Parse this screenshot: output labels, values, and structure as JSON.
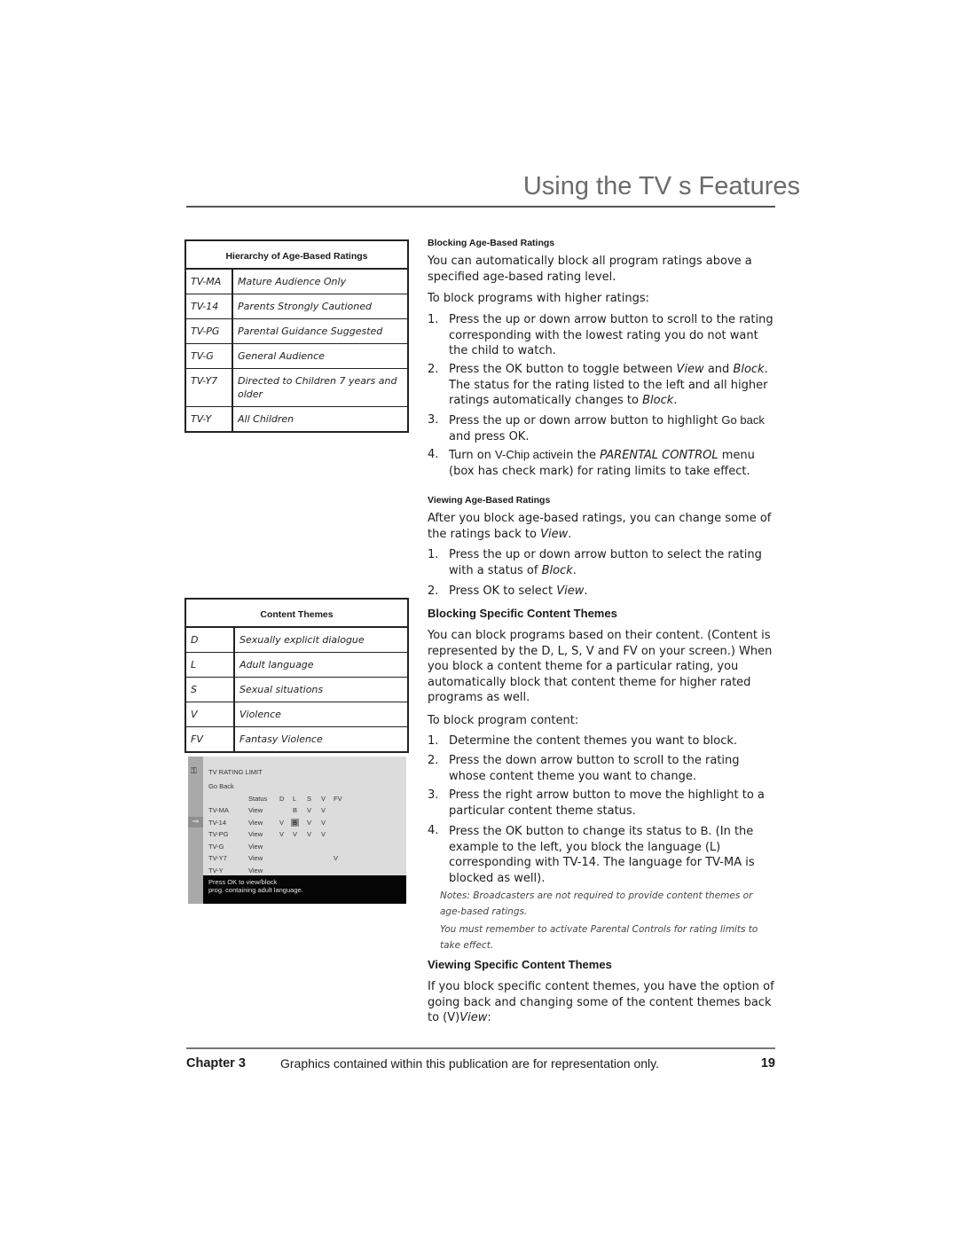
{
  "header": {
    "title": "Using the TV s Features"
  },
  "ratings_table": {
    "title": "Hierarchy of Age-Based Ratings",
    "rows": [
      {
        "code": "TV-MA",
        "desc": "Mature Audience Only"
      },
      {
        "code": "TV-14",
        "desc": "Parents Strongly Cautioned"
      },
      {
        "code": "TV-PG",
        "desc": "Parental Guidance Suggested"
      },
      {
        "code": "TV-G",
        "desc": "General Audience"
      },
      {
        "code": "TV-Y7",
        "desc": "Directed to Children 7 years and older"
      },
      {
        "code": "TV-Y",
        "desc": "All Children"
      }
    ]
  },
  "themes_table": {
    "title": "Content Themes",
    "rows": [
      {
        "code": "D",
        "desc": "Sexually explicit dialogue"
      },
      {
        "code": "L",
        "desc": "Adult language"
      },
      {
        "code": "S",
        "desc": "Sexual situations"
      },
      {
        "code": "V",
        "desc": "Violence"
      },
      {
        "code": "FV",
        "desc": "Fantasy Violence"
      }
    ]
  },
  "tv_screen": {
    "icon": "key-icon",
    "title": "TV RATING LIMIT",
    "go_back": "Go Back",
    "columns": [
      "Status",
      "D",
      "L",
      "S",
      "V",
      "FV"
    ],
    "rows": [
      {
        "rating": "TV-MA",
        "status": "View",
        "D": "",
        "L": "B",
        "S": "V",
        "V": "V",
        "FV": ""
      },
      {
        "rating": "TV-14",
        "status": "View",
        "D": "V",
        "L": "B",
        "S": "V",
        "V": "V",
        "FV": ""
      },
      {
        "rating": "TV-PG",
        "status": "View",
        "D": "V",
        "L": "V",
        "S": "V",
        "V": "V",
        "FV": ""
      },
      {
        "rating": "TV-G",
        "status": "View",
        "D": "",
        "L": "",
        "S": "",
        "V": "",
        "FV": ""
      },
      {
        "rating": "TV-Y7",
        "status": "View",
        "D": "",
        "L": "",
        "S": "",
        "V": "",
        "FV": "V"
      },
      {
        "rating": "TV-Y",
        "status": "View",
        "D": "",
        "L": "",
        "S": "",
        "V": "",
        "FV": ""
      }
    ],
    "selected_row": "TV-14",
    "highlighted_cell": "L",
    "footer_line1": "Press OK to view/block",
    "footer_line2": "prog. containing adult language."
  },
  "right_column": {
    "blocking_age": {
      "heading": "Blocking Age-Based Ratings",
      "intro": "You can automatically block all program ratings above a specified age-based rating level.",
      "lead": "To block programs with higher ratings:",
      "steps": [
        {
          "n": "1.",
          "text": "Press the up or down arrow button to scroll to the rating corresponding with the lowest rating you do not want the child to watch."
        },
        {
          "n": "2.",
          "a": "Press the OK button to toggle between ",
          "b": "View",
          "c": " and ",
          "d": "Block",
          "e": ". The status for the rating listed to the left and all higher ratings automatically changes to ",
          "f": "Block",
          "g": "."
        },
        {
          "n": "3.",
          "a": "Press the up or down arrow button to highlight ",
          "b": "Go back",
          "c": " and press OK."
        },
        {
          "n": "4.",
          "a": "Turn on ",
          "b": "V-Chip active",
          "c": "in the ",
          "d": "PARENTAL CONTROL",
          "e": " menu (box has check mark) for rating limits to take effect."
        }
      ]
    },
    "viewing_age": {
      "heading": "Viewing Age-Based Ratings",
      "intro_a": "After you block age-based ratings, you can change some of the ratings back to ",
      "intro_b": "View",
      "intro_c": ".",
      "steps": [
        {
          "n": "1.",
          "a": "Press the up or down arrow button to select the rating with a status of ",
          "b": "Block",
          "c": "."
        },
        {
          "n": "2.",
          "a": "Press OK to select ",
          "b": "View",
          "c": "."
        }
      ]
    },
    "blocking_themes": {
      "heading": "Blocking Specific Content Themes",
      "intro": "You can block programs based on their content. (Content is represented by the D, L, S, V and FV on your screen.) When you block a content theme for a particular rating, you automatically block that content theme for higher rated programs as well.",
      "lead": "To block program content:",
      "steps": [
        {
          "n": "1.",
          "text": "Determine the content themes you want to block."
        },
        {
          "n": "2.",
          "text": "Press the down arrow button to scroll to the rating whose content theme you want to change."
        },
        {
          "n": "3.",
          "text": "Press the right arrow button to move the highlight to a particular content theme status."
        },
        {
          "n": "4.",
          "a": "Press the OK button to change its status to ",
          "b": "B",
          "c": ". (In the example to the left, you block the language (L) corresponding with TV-14. The language for TV-MA is blocked as well)."
        }
      ],
      "note1": "Notes: Broadcasters are not required to provide content themes or age-based ratings.",
      "note2": "You must remember to activate Parental Controls for rating limits to take effect."
    },
    "viewing_themes": {
      "heading": "Viewing Specific Content Themes",
      "intro_a": "If you block specific content themes, you have the option of going back and changing some of the content themes back to (V)",
      "intro_b": "View",
      "intro_c": ":"
    }
  },
  "footer": {
    "chapter": "Chapter 3",
    "note": "Graphics contained within this publication are for representation only.",
    "page": "19"
  }
}
